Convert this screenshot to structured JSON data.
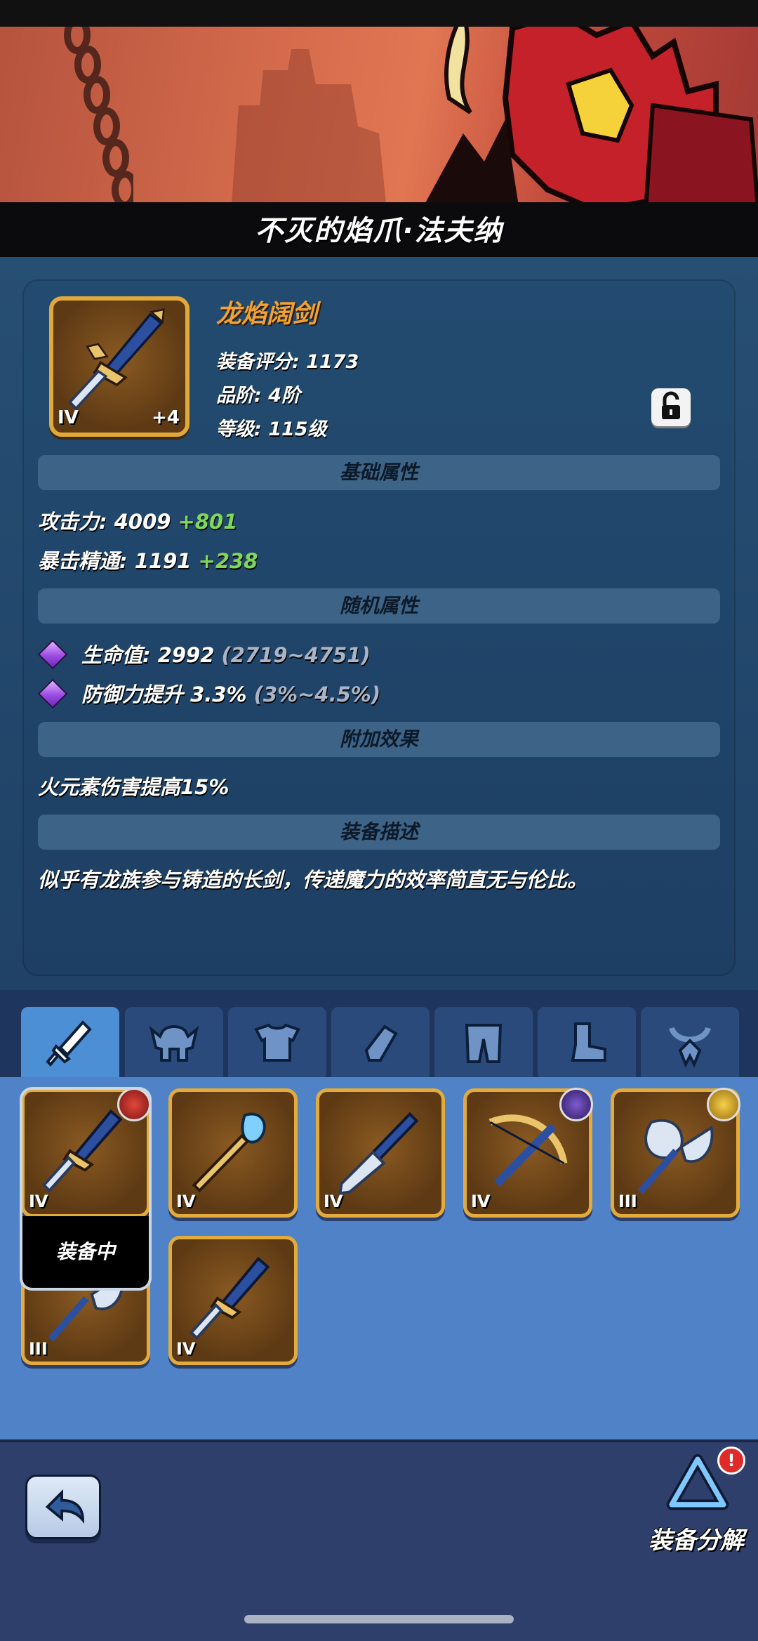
{
  "banner": {
    "title": "不灭的焰爪·法夫纳"
  },
  "item": {
    "name": "龙焰阔剑",
    "tier_roman": "IV",
    "enhance": "+4",
    "score_label": "装备评分: 1173",
    "grade_label": "品阶: 4阶",
    "level_label": "等级: 115级"
  },
  "sections": {
    "base": "基础属性",
    "random": "随机属性",
    "extra": "附加效果",
    "desc": "装备描述"
  },
  "base_stats": [
    {
      "label": "攻击力:",
      "value": "4009",
      "bonus": "+801"
    },
    {
      "label": "暴击精通:",
      "value": "1191",
      "bonus": "+238"
    }
  ],
  "random_stats": [
    {
      "text": "生命值: 2992",
      "range": "(2719~4751)"
    },
    {
      "text": "防御力提升 3.3%",
      "range": "(3%~4.5%)"
    }
  ],
  "extra_effect": "火元素伤害提高15%",
  "description": "似乎有龙族参与铸造的长剑，传递魔力的效率简直无与伦比。",
  "tabs": [
    {
      "icon": "sword-icon",
      "active": true
    },
    {
      "icon": "helmet-icon",
      "active": false
    },
    {
      "icon": "armor-icon",
      "active": false
    },
    {
      "icon": "gauntlet-icon",
      "active": false
    },
    {
      "icon": "pants-icon",
      "active": false
    },
    {
      "icon": "boots-icon",
      "active": false
    },
    {
      "icon": "necklace-icon",
      "active": false
    }
  ],
  "inventory": [
    {
      "icon": "sword-icon",
      "tier": "IV",
      "badge": "red"
    },
    {
      "icon": "staff-icon",
      "tier": "IV"
    },
    {
      "icon": "spear-icon",
      "tier": "IV"
    },
    {
      "icon": "crossbow-icon",
      "tier": "IV",
      "badge": "purple"
    },
    {
      "icon": "axe-icon",
      "tier": "III",
      "badge": "gold"
    },
    {
      "icon": "axe-icon",
      "tier": "III"
    },
    {
      "icon": "sword-icon",
      "tier": "IV"
    }
  ],
  "equipped_label": "装备中",
  "footer": {
    "decompose_label": "装备分解",
    "alert": "!"
  },
  "colors": {
    "gold": "#f2a230",
    "green_bonus": "#7ed957",
    "tab_active": "#4d8fd4",
    "grid_bg": "#4f82c6"
  }
}
